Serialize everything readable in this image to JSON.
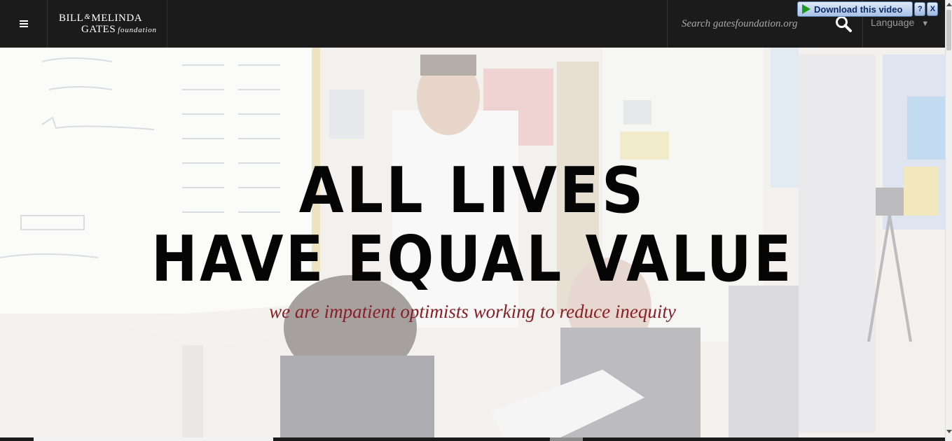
{
  "header": {
    "logo": {
      "line1_a": "BILL",
      "line1_amp": "&",
      "line1_b": "MELINDA",
      "line2_a": "GATES",
      "line2_b": "foundation"
    },
    "search_placeholder": "Search gatesfoundation.org",
    "language_label": "Language",
    "language_caret": "▼"
  },
  "download_widget": {
    "label": "Download this video",
    "help": "?",
    "close": "X"
  },
  "hero": {
    "headline_line1": "ALL LIVES",
    "headline_line2": "HAVE EQUAL VALUE",
    "tagline": "we are impatient optimists working to reduce inequity"
  },
  "colors": {
    "header_bg": "#1b1b1b",
    "headline": "#050505",
    "tagline": "#8a1e24"
  }
}
